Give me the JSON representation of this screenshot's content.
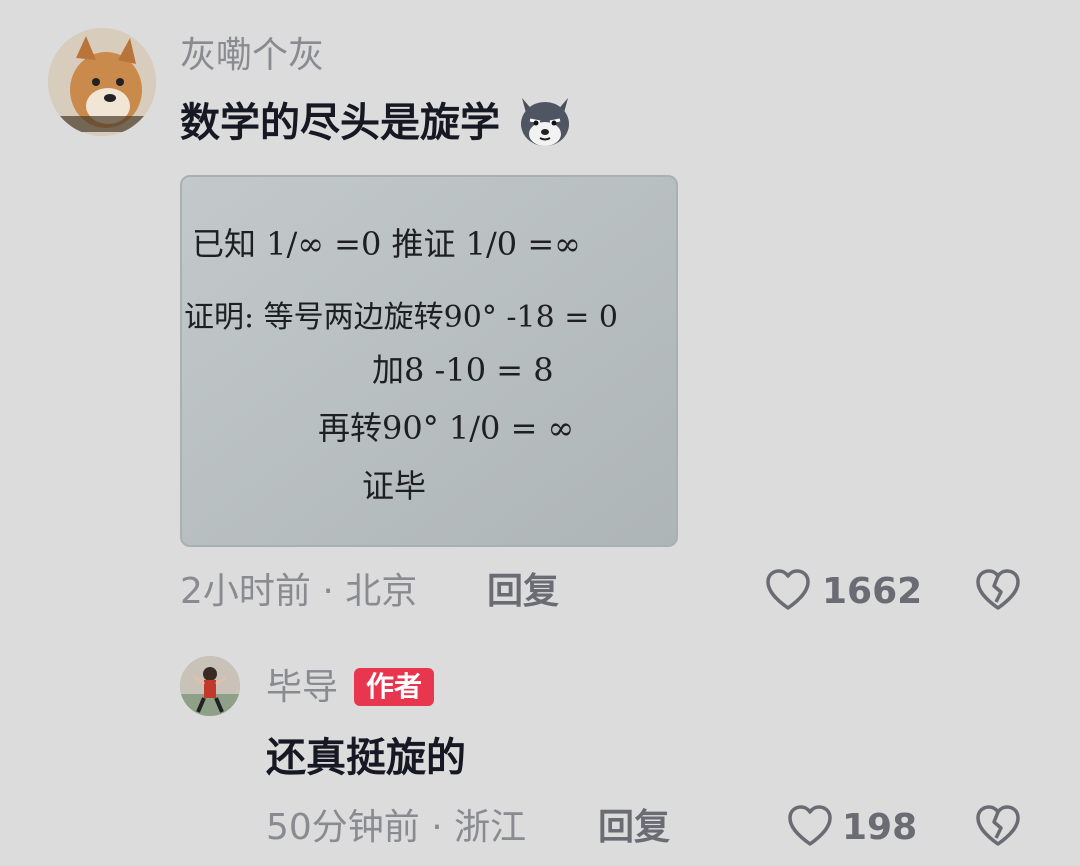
{
  "comment": {
    "username": "灰嘞个灰",
    "text": "数学的尽头是旋学",
    "emoji_icon": "wolf-face-emoji",
    "image": {
      "lines": [
        "已知 1/∞ =0    推证 1/0 =∞",
        "证明: 等号两边旋转90°   -18 = 0",
        "加8   -10 = 8",
        "再转90°   1/0 = ∞",
        "证毕"
      ]
    },
    "time": "2小时前",
    "location": "北京",
    "reply_label": "回复",
    "likes": "1662"
  },
  "reply": {
    "username": "毕导",
    "badge": "作者",
    "text": "还真挺旋的",
    "time": "50分钟前",
    "location": "浙江",
    "reply_label": "回复",
    "likes": "198"
  },
  "colors": {
    "background": "#dcdcdc",
    "badge": "#e8364f",
    "meta_text": "#8a8b91"
  }
}
